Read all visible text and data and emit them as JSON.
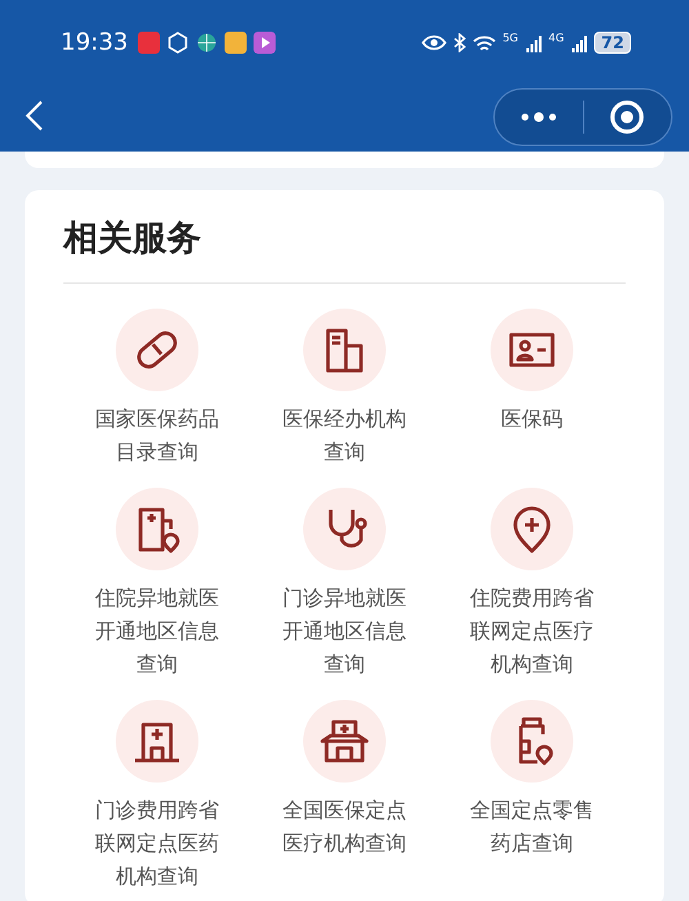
{
  "status_bar": {
    "time": "19:33",
    "network_1": "5G",
    "network_2": "4G",
    "battery": "72"
  },
  "section": {
    "title": "相关服务",
    "services": [
      {
        "label": "国家医保药品目录查询"
      },
      {
        "label": "医保经办机构查询"
      },
      {
        "label": "医保码"
      },
      {
        "label": "住院异地就医开通地区信息查询"
      },
      {
        "label": "门诊异地就医开通地区信息查询"
      },
      {
        "label": "住院费用跨省联网定点医疗机构查询"
      },
      {
        "label": "门诊费用跨省联网定点医药机构查询"
      },
      {
        "label": "全国医保定点医疗机构查询"
      },
      {
        "label": "全国定点零售药店查询"
      }
    ]
  }
}
